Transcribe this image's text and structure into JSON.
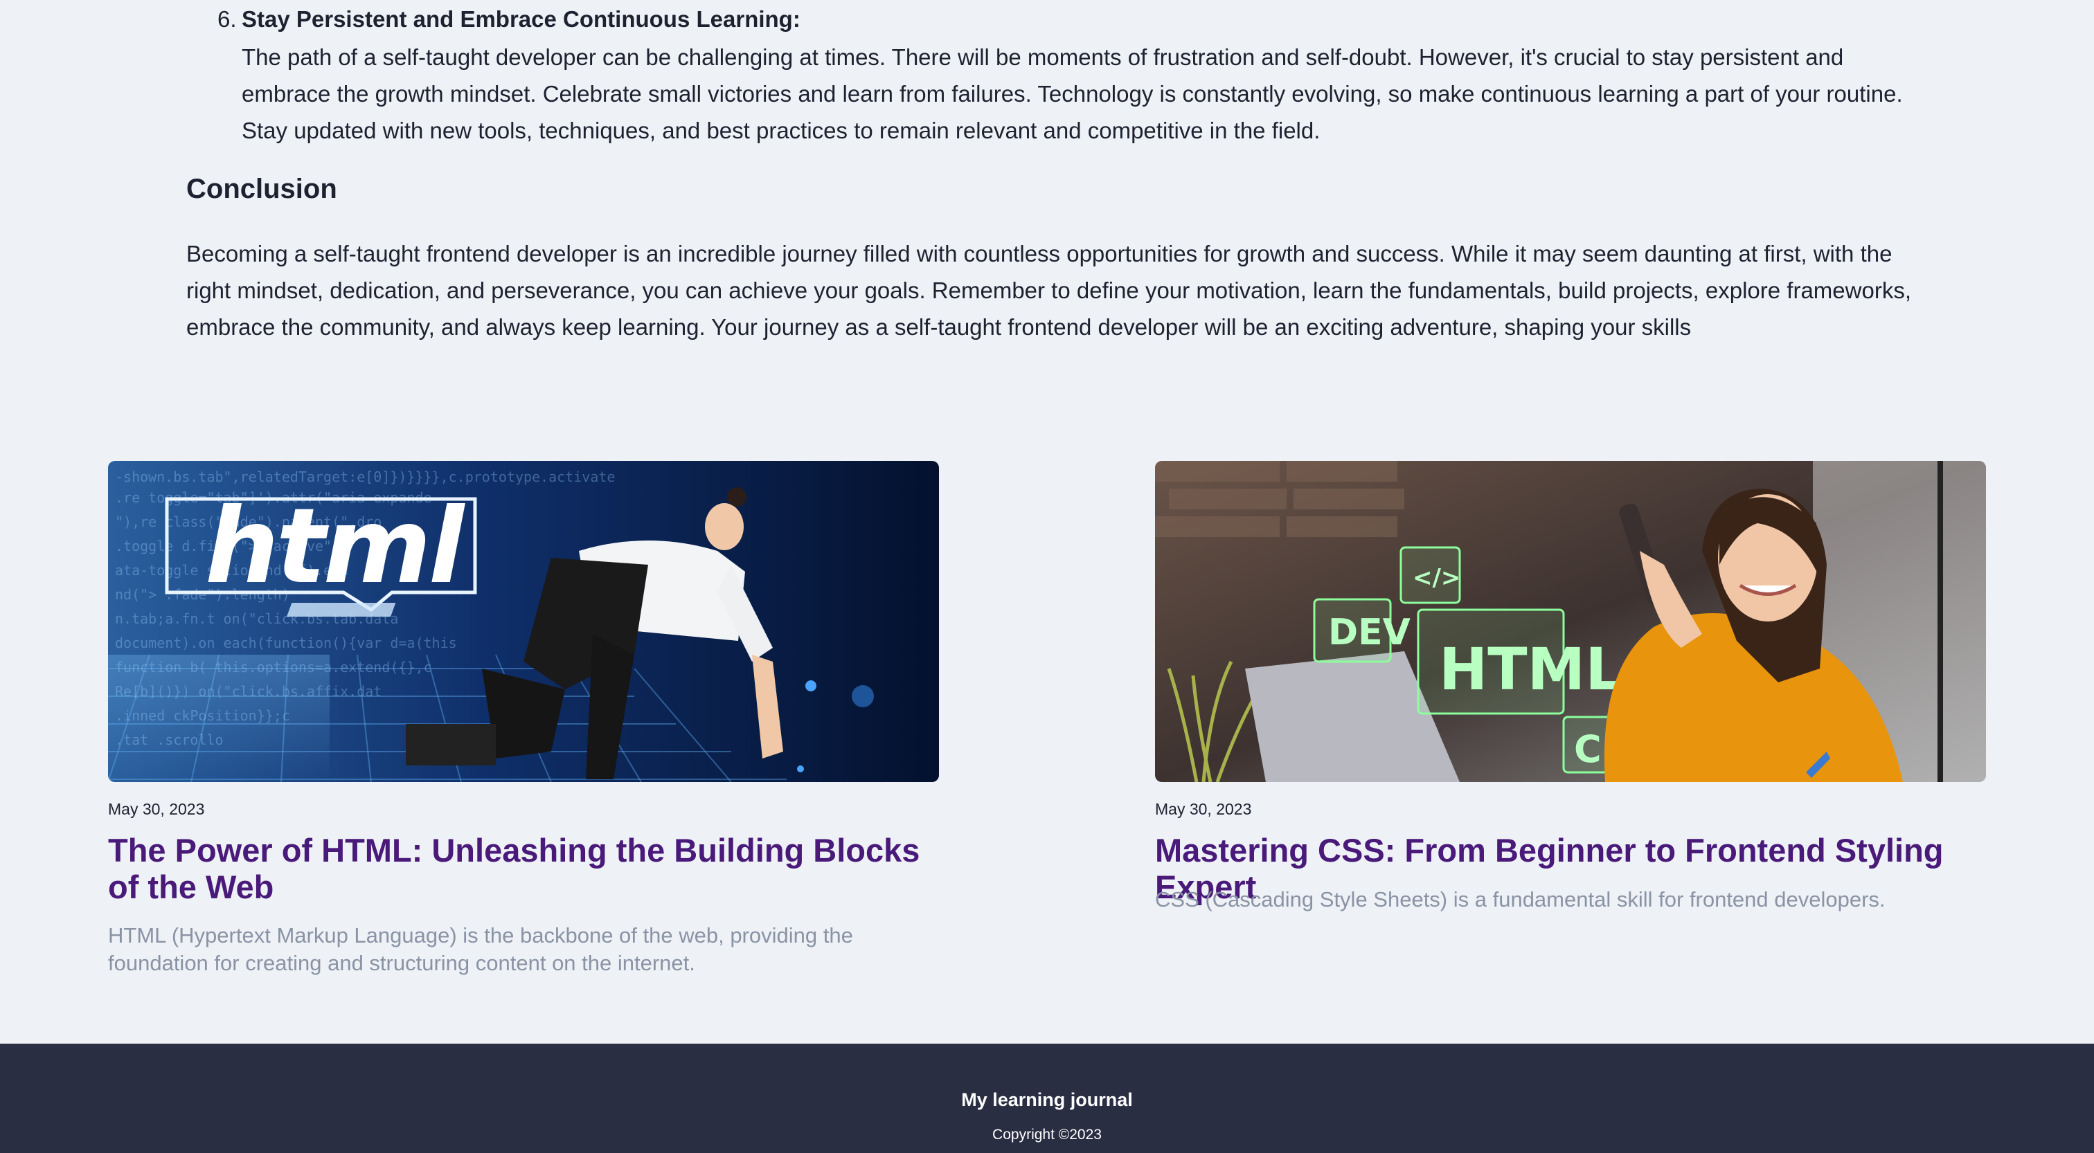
{
  "article": {
    "step": {
      "number": "6.",
      "title": "Stay Persistent and Embrace Continuous Learning:",
      "body": "The path of a self-taught developer can be challenging at times. There will be moments of frustration and self-doubt. However, it's crucial to stay persistent and embrace the growth mindset. Celebrate small victories and learn from failures. Technology is constantly evolving, so make continuous learning a part of your routine. Stay updated with new tools, techniques, and best practices to remain relevant and competitive in the field."
    },
    "conclusion": {
      "heading": "Conclusion",
      "text": "Becoming a self-taught frontend developer is an incredible journey filled with countless opportunities for growth and success. While it may seem daunting at first, with the right mindset, dedication, and perseverance, you can achieve your goals. Remember to define your motivation, learn the fundamentals, build projects, explore frameworks, embrace the community, and always keep learning. Your journey as a self-taught frontend developer will be an exciting adventure, shaping your skills"
    }
  },
  "cards": [
    {
      "date": "May 30, 2023",
      "title": "The Power of HTML: Unleashing the Building Blocks of the Web",
      "excerpt": "HTML (Hypertext Markup Language) is the backbone of the web, providing the foundation for creating and structuring content on the internet.",
      "image_text": "html"
    },
    {
      "date": "May 30, 2023",
      "title": "Mastering CSS: From Beginner to Frontend Styling Expert",
      "excerpt": "CSS (Cascading Style Sheets) is a fundamental skill for frontend developers.",
      "image_labels": [
        "DEV",
        "</>",
        "HTML",
        "CSS"
      ]
    }
  ],
  "footer": {
    "title": "My learning journal",
    "copyright": "Copyright ©2023"
  },
  "colors": {
    "background": "#eef2f6",
    "text": "#1e2130",
    "card_title": "#4a1a7a",
    "excerpt": "#8a93a5",
    "footer_bg": "#2a2e42"
  }
}
